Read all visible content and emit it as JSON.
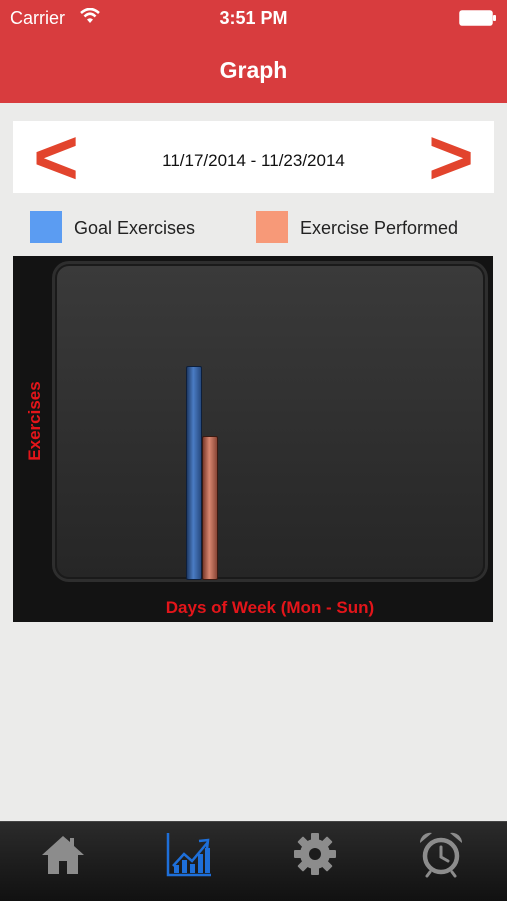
{
  "status_bar": {
    "carrier": "Carrier",
    "time": "3:51 PM"
  },
  "nav": {
    "title": "Graph"
  },
  "date_selector": {
    "prev_label": "<",
    "range": "11/17/2014 - 11/23/2014",
    "next_label": ">"
  },
  "legend": {
    "goal": {
      "label": "Goal Exercises",
      "color": "#5b9cf2"
    },
    "performed": {
      "label": "Exercise Performed",
      "color": "#f79978"
    }
  },
  "chart_data": {
    "type": "bar",
    "xlabel": "Days of Week (Mon - Sun)",
    "ylabel": "Exercises",
    "series": [
      {
        "name": "Goal Exercises",
        "values": [
          1
        ]
      },
      {
        "name": "Exercise Performed",
        "values": [
          0.67
        ]
      }
    ]
  },
  "tab_bar": {
    "tabs": [
      {
        "icon": "home-icon",
        "active": false
      },
      {
        "icon": "chart-icon",
        "active": true
      },
      {
        "icon": "gear-icon",
        "active": false
      },
      {
        "icon": "alarm-clock-icon",
        "active": false
      }
    ],
    "active_color": "#1e6fd9",
    "inactive_color": "#8c8c8c"
  }
}
